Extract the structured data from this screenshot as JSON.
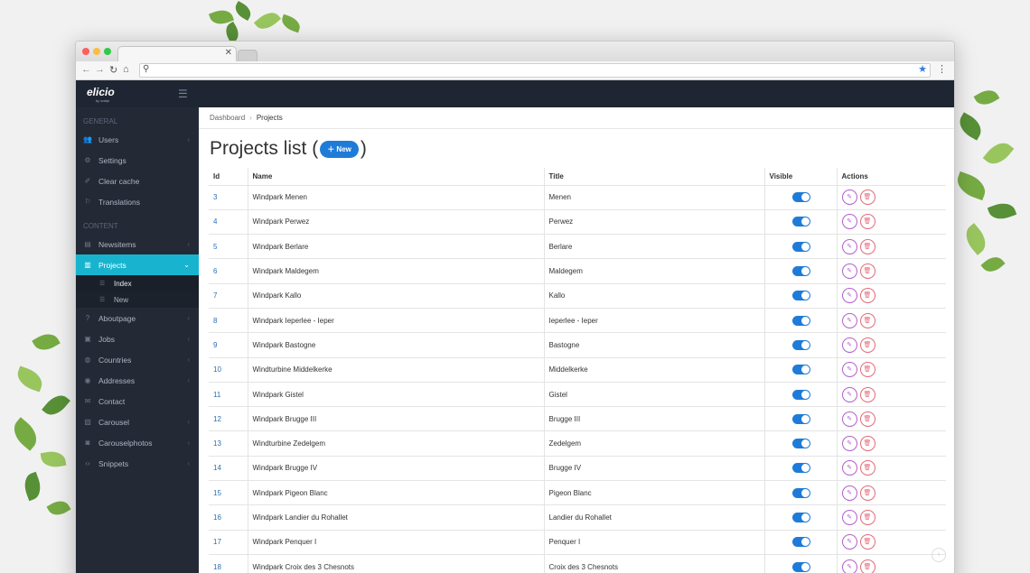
{
  "app": {
    "logo": "elicio",
    "logo_tag": "by sobip"
  },
  "breadcrumb": {
    "root": "Dashboard",
    "current": "Projects"
  },
  "page": {
    "title": "Projects list (",
    "title_end": ")",
    "new_label": "New"
  },
  "sidebar": {
    "general_label": "GENERAL",
    "content_label": "CONTENT",
    "general_items": [
      {
        "label": "Users",
        "icon": "users-icon",
        "chevron": true
      },
      {
        "label": "Settings",
        "icon": "gear-icon",
        "chevron": false
      },
      {
        "label": "Clear cache",
        "icon": "eraser-icon",
        "chevron": false
      },
      {
        "label": "Translations",
        "icon": "flag-icon",
        "chevron": false
      }
    ],
    "content_items": [
      {
        "label": "Newsitems",
        "icon": "newspaper-icon",
        "chevron": true
      },
      {
        "label": "Projects",
        "icon": "chart-icon",
        "chevron": true,
        "active": true
      }
    ],
    "projects_sub": [
      "Index",
      "New"
    ],
    "more_items": [
      {
        "label": "Aboutpage",
        "icon": "question-icon",
        "chevron": true
      },
      {
        "label": "Jobs",
        "icon": "briefcase-icon",
        "chevron": true
      },
      {
        "label": "Countries",
        "icon": "globe-icon",
        "chevron": true
      },
      {
        "label": "Addresses",
        "icon": "map-pin-icon",
        "chevron": true
      },
      {
        "label": "Contact",
        "icon": "envelope-icon",
        "chevron": false
      },
      {
        "label": "Carousel",
        "icon": "image-icon",
        "chevron": true
      },
      {
        "label": "Carouselphotos",
        "icon": "camera-icon",
        "chevron": true
      },
      {
        "label": "Snippets",
        "icon": "code-icon",
        "chevron": true
      }
    ]
  },
  "table": {
    "headers": {
      "id": "Id",
      "name": "Name",
      "title": "Title",
      "visible": "Visible",
      "actions": "Actions"
    },
    "rows": [
      {
        "id": "3",
        "name": "Windpark Menen",
        "title": "Menen"
      },
      {
        "id": "4",
        "name": "Windpark Perwez",
        "title": "Perwez"
      },
      {
        "id": "5",
        "name": "Windpark Berlare",
        "title": "Berlare"
      },
      {
        "id": "6",
        "name": "Windpark Maldegem",
        "title": "Maldegem"
      },
      {
        "id": "7",
        "name": "Windpark Kallo",
        "title": "Kallo"
      },
      {
        "id": "8",
        "name": "Windpark Ieperlee - Ieper",
        "title": "Ieperlee - Ieper"
      },
      {
        "id": "9",
        "name": "Windpark Bastogne",
        "title": "Bastogne"
      },
      {
        "id": "10",
        "name": "Windturbine Middelkerke",
        "title": "Middelkerke"
      },
      {
        "id": "11",
        "name": "Windpark Gistel",
        "title": "Gistel"
      },
      {
        "id": "12",
        "name": "Windpark Brugge III",
        "title": "Brugge III"
      },
      {
        "id": "13",
        "name": "Windturbine Zedelgem",
        "title": "Zedelgem"
      },
      {
        "id": "14",
        "name": "Windpark Brugge IV",
        "title": "Brugge IV"
      },
      {
        "id": "15",
        "name": "Windpark Pigeon Blanc",
        "title": "Pigeon Blanc"
      },
      {
        "id": "16",
        "name": "Windpark Landier du Rohallet",
        "title": "Landier du Rohallet"
      },
      {
        "id": "17",
        "name": "Windpark Penquer I",
        "title": "Penquer I"
      },
      {
        "id": "18",
        "name": "Windpark Croix des 3 Chesnots",
        "title": "Croix des 3 Chesnots"
      }
    ]
  },
  "colors": {
    "accent": "#18b4cf",
    "primary": "#1f7bd8",
    "sidebar": "#232a36"
  }
}
